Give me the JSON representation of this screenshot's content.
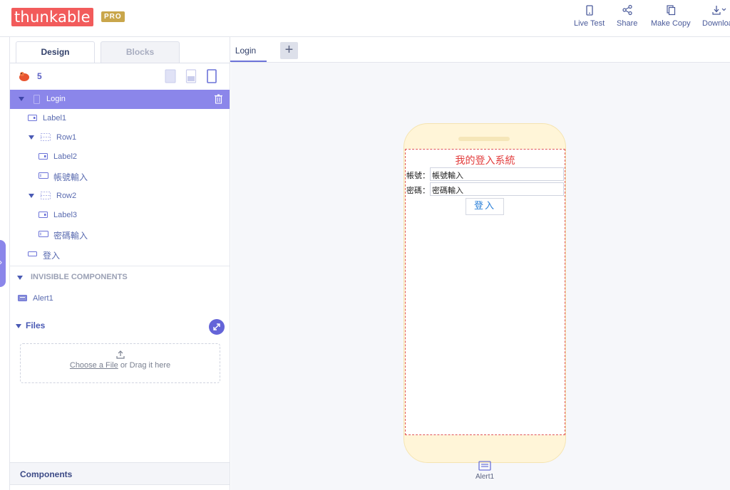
{
  "header": {
    "logo_text": "thunkable",
    "badge": "PRO",
    "tools": [
      {
        "label": "Live Test",
        "icon": "phone-icon"
      },
      {
        "label": "Share",
        "icon": "share-icon"
      },
      {
        "label": "Make Copy",
        "icon": "copy-icon"
      },
      {
        "label": "Download",
        "icon": "download-icon"
      }
    ]
  },
  "mode_tabs": {
    "design": "Design",
    "blocks": "Blocks"
  },
  "screen_tabs": {
    "current": "Login",
    "add": "+"
  },
  "project": {
    "count": "5"
  },
  "tree": [
    {
      "label": "Login",
      "type": "screen"
    },
    {
      "label": "Label1",
      "type": "label"
    },
    {
      "label": "Row1",
      "type": "row"
    },
    {
      "label": "Label2",
      "type": "label"
    },
    {
      "label": "帳號輸入",
      "type": "textinput"
    },
    {
      "label": "Row2",
      "type": "row"
    },
    {
      "label": "Label3",
      "type": "label"
    },
    {
      "label": "密碼輸入",
      "type": "textinput"
    },
    {
      "label": "登入",
      "type": "button"
    }
  ],
  "invisible": {
    "heading": "INVISIBLE COMPONENTS",
    "items": [
      {
        "label": "Alert1"
      }
    ]
  },
  "files": {
    "heading": "Files",
    "choose": "Choose a File",
    "rest": "or Drag it here"
  },
  "components_bar": "Components",
  "app": {
    "title": "我的登入系統",
    "row1_label": "帳號：",
    "row1_value": "帳號輸入",
    "row2_label": "密碼：",
    "row2_value": "密碼輸入",
    "button": "登入"
  },
  "canvas_alert": "Alert1",
  "colors": {
    "accent": "#8b86ea",
    "logo": "#f25b5b",
    "badge": "#c9a64b",
    "title_red": "#e23b3b"
  }
}
